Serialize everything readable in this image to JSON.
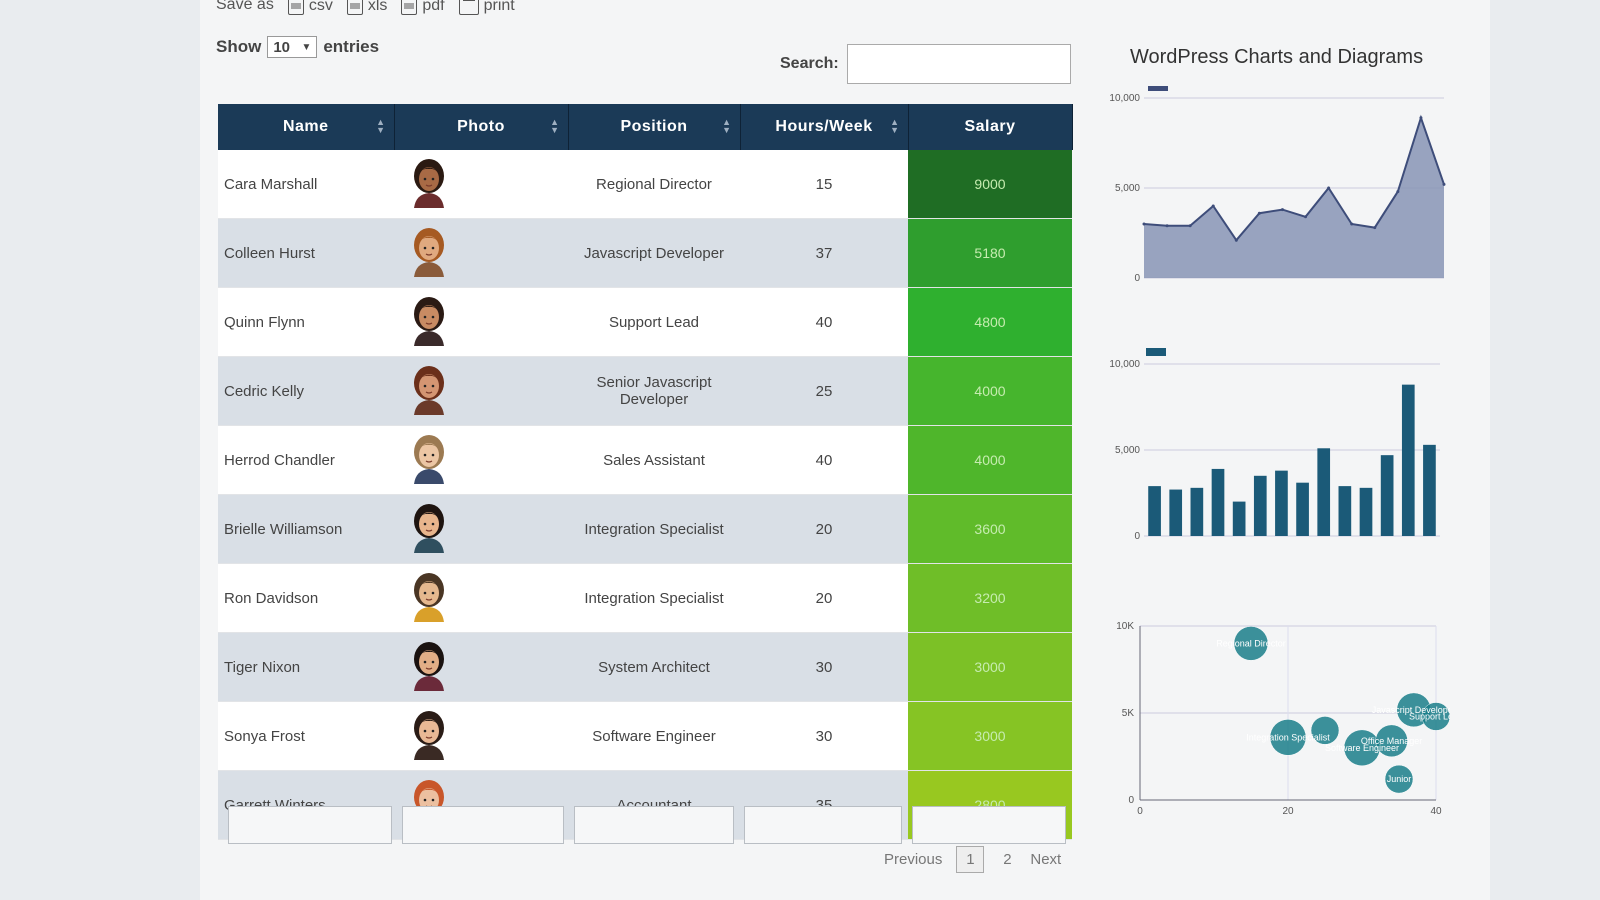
{
  "toolbar": {
    "save_as": "Save as",
    "items": [
      {
        "label": "csv",
        "icon": "csv-file-icon"
      },
      {
        "label": "xls",
        "icon": "xls-file-icon"
      },
      {
        "label": "pdf",
        "icon": "pdf-file-icon"
      },
      {
        "label": "print",
        "icon": "print-icon"
      }
    ]
  },
  "length_menu": {
    "show": "Show",
    "value": "10",
    "entries": "entries"
  },
  "search": {
    "label": "Search:",
    "value": ""
  },
  "table": {
    "columns": [
      "Name",
      "Photo",
      "Position",
      "Hours/Week",
      "Salary"
    ],
    "header_bg": "#1b3a57",
    "rows": [
      {
        "name": "Cara Marshall",
        "position": "Regional Director",
        "hours": "15",
        "salary": "9000",
        "avatar": {
          "hair": "#2b1a12",
          "skin": "#a86a45",
          "shirt": "#6b2c2c"
        },
        "heat": "#1f6d24"
      },
      {
        "name": "Colleen Hurst",
        "position": "Javascript Developer",
        "hours": "37",
        "salary": "5180",
        "avatar": {
          "hair": "#a65a22",
          "skin": "#e0a97f",
          "shirt": "#8a5b3a"
        },
        "heat": "#2f9e2e"
      },
      {
        "name": "Quinn Flynn",
        "position": "Support Lead",
        "hours": "40",
        "salary": "4800",
        "avatar": {
          "hair": "#2a1a14",
          "skin": "#c88b63",
          "shirt": "#3a2a2a"
        },
        "heat": "#2fb02f"
      },
      {
        "name": "Cedric Kelly",
        "position": "Senior Javascript Developer",
        "hours": "25",
        "salary": "4000",
        "avatar": {
          "hair": "#6b2f1a",
          "skin": "#d49572",
          "shirt": "#6b3a2a"
        },
        "heat": "#46b52d"
      },
      {
        "name": "Herrod Chandler",
        "position": "Sales Assistant",
        "hours": "40",
        "salary": "4000",
        "avatar": {
          "hair": "#9c7a52",
          "skin": "#ecc6a4",
          "shirt": "#3a4a6b"
        },
        "heat": "#4fb62b"
      },
      {
        "name": "Brielle Williamson",
        "position": "Integration Specialist",
        "hours": "20",
        "salary": "3600",
        "avatar": {
          "hair": "#1e1410",
          "skin": "#e8b58c",
          "shirt": "#2f4f5f"
        },
        "heat": "#60bb2a"
      },
      {
        "name": "Ron Davidson",
        "position": "Integration Specialist",
        "hours": "20",
        "salary": "3200",
        "avatar": {
          "hair": "#4a3624",
          "skin": "#e5b88e",
          "shirt": "#d9a02a"
        },
        "heat": "#6fbe28"
      },
      {
        "name": "Tiger Nixon",
        "position": "System Architect",
        "hours": "30",
        "salary": "3000",
        "avatar": {
          "hair": "#1a1210",
          "skin": "#e2ae86",
          "shirt": "#6b2a3a"
        },
        "heat": "#7cc126"
      },
      {
        "name": "Sonya Frost",
        "position": "Software Engineer",
        "hours": "30",
        "salary": "3000",
        "avatar": {
          "hair": "#2a1c16",
          "skin": "#e8b895",
          "shirt": "#3a2a24"
        },
        "heat": "#86c424"
      },
      {
        "name": "Garrett Winters",
        "position": "Accountant",
        "hours": "35",
        "salary": "2800",
        "avatar": {
          "hair": "#c8562a",
          "skin": "#ecc0a0",
          "shirt": "#3a7fa6"
        },
        "heat": "#98c820"
      }
    ]
  },
  "pagination": {
    "previous": "Previous",
    "pages": [
      "1",
      "2"
    ],
    "current": "1",
    "next": "Next"
  },
  "charts_title": "WordPress Charts and Diagrams",
  "chart_data": [
    {
      "type": "area",
      "y_ticks": [
        "10,000",
        "5,000",
        "0"
      ],
      "ylim": [
        0,
        10000
      ],
      "values": [
        3000,
        2900,
        2900,
        4000,
        2100,
        3600,
        3800,
        3400,
        5000,
        3000,
        2800,
        4800,
        8900,
        5200
      ],
      "color": "#8794b5",
      "legend_swatch": "#3e4d7a"
    },
    {
      "type": "bar",
      "y_ticks": [
        "10,000",
        "5,000",
        "0"
      ],
      "ylim": [
        0,
        10000
      ],
      "values": [
        2900,
        2700,
        2800,
        3900,
        2000,
        3500,
        3800,
        3100,
        5100,
        2900,
        2800,
        4700,
        8800,
        5300
      ],
      "color": "#1b5a78",
      "legend_swatch": "#1b5a78"
    },
    {
      "type": "scatter",
      "y_ticks": [
        "10K",
        "5K",
        "0"
      ],
      "x_ticks": [
        "0",
        "20",
        "40"
      ],
      "xlim": [
        0,
        40
      ],
      "ylim": [
        0,
        10000
      ],
      "color": "#1b7f8a",
      "points": [
        {
          "x": 15,
          "y": 9000,
          "r": 17,
          "label": "Regional Director"
        },
        {
          "x": 20,
          "y": 3600,
          "r": 18,
          "label": "Integration Specialist"
        },
        {
          "x": 25,
          "y": 4000,
          "r": 14,
          "label": ""
        },
        {
          "x": 30,
          "y": 3000,
          "r": 18,
          "label": "Software Engineer"
        },
        {
          "x": 34,
          "y": 3400,
          "r": 16,
          "label": "Office Manager"
        },
        {
          "x": 37,
          "y": 5180,
          "r": 17,
          "label": "Javascript Developer"
        },
        {
          "x": 40,
          "y": 4800,
          "r": 14,
          "label": "Support Lead"
        },
        {
          "x": 35,
          "y": 1200,
          "r": 14,
          "label": "Junior"
        }
      ]
    }
  ]
}
